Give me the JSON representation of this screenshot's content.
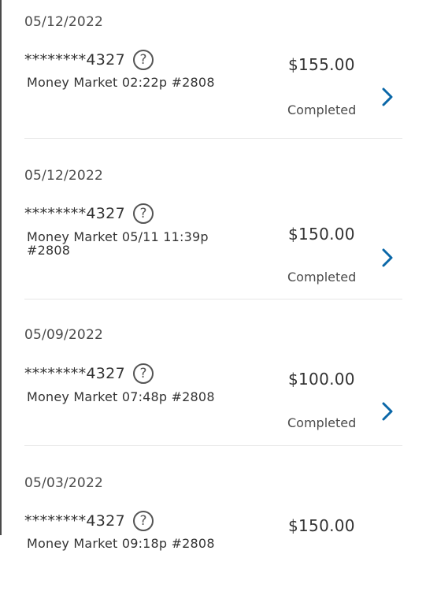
{
  "transactions": [
    {
      "date": "05/12/2022",
      "account": "********4327",
      "description": "Money Market 02:22p #2808",
      "amount": "$155.00",
      "status": "Completed"
    },
    {
      "date": "05/12/2022",
      "account": "********4327",
      "description": "Money Market 05/11 11:39p #2808",
      "amount": "$150.00",
      "status": "Completed"
    },
    {
      "date": "05/09/2022",
      "account": "********4327",
      "description": "Money Market 07:48p #2808",
      "amount": "$100.00",
      "status": "Completed"
    },
    {
      "date": "05/03/2022",
      "account": "********4327",
      "description": "Money Market 09:18p #2808",
      "amount": "$150.00",
      "status": ""
    }
  ],
  "icons": {
    "help": "?",
    "chevron_color": "#0a67a8"
  }
}
